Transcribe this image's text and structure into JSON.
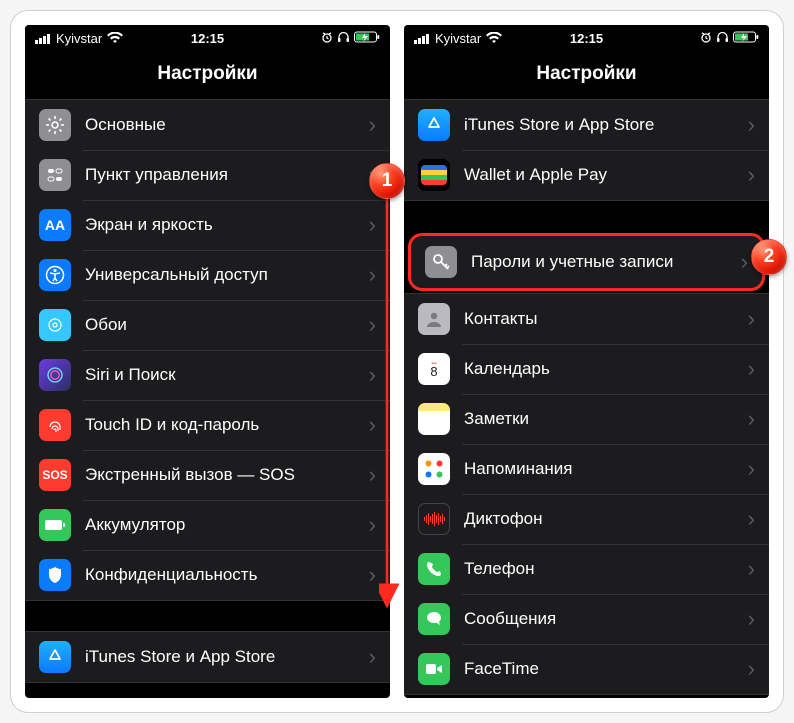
{
  "status": {
    "carrier": "Kyivstar",
    "time": "12:15"
  },
  "left": {
    "title": "Настройки",
    "items": [
      {
        "label": "Основные"
      },
      {
        "label": "Пункт управления"
      },
      {
        "label": "Экран и яркость"
      },
      {
        "label": "Универсальный доступ"
      },
      {
        "label": "Обои"
      },
      {
        "label": "Siri и Поиск"
      },
      {
        "label": "Touch ID и код-пароль"
      },
      {
        "label": "Экстренный вызов — SOS"
      },
      {
        "label": "Аккумулятор"
      },
      {
        "label": "Конфиденциальность"
      }
    ],
    "bottom": {
      "label": "iTunes Store и App Store"
    }
  },
  "right": {
    "title": "Настройки",
    "group1": [
      {
        "label": "iTunes Store и App Store"
      },
      {
        "label": "Wallet и Apple Pay"
      }
    ],
    "passwords": {
      "label": "Пароли и учетные записи"
    },
    "group2": [
      {
        "label": "Контакты"
      },
      {
        "label": "Календарь"
      },
      {
        "label": "Заметки"
      },
      {
        "label": "Напоминания"
      },
      {
        "label": "Диктофон"
      },
      {
        "label": "Телефон"
      },
      {
        "label": "Сообщения"
      },
      {
        "label": "FaceTime"
      }
    ]
  },
  "markers": {
    "one": "1",
    "two": "2"
  }
}
